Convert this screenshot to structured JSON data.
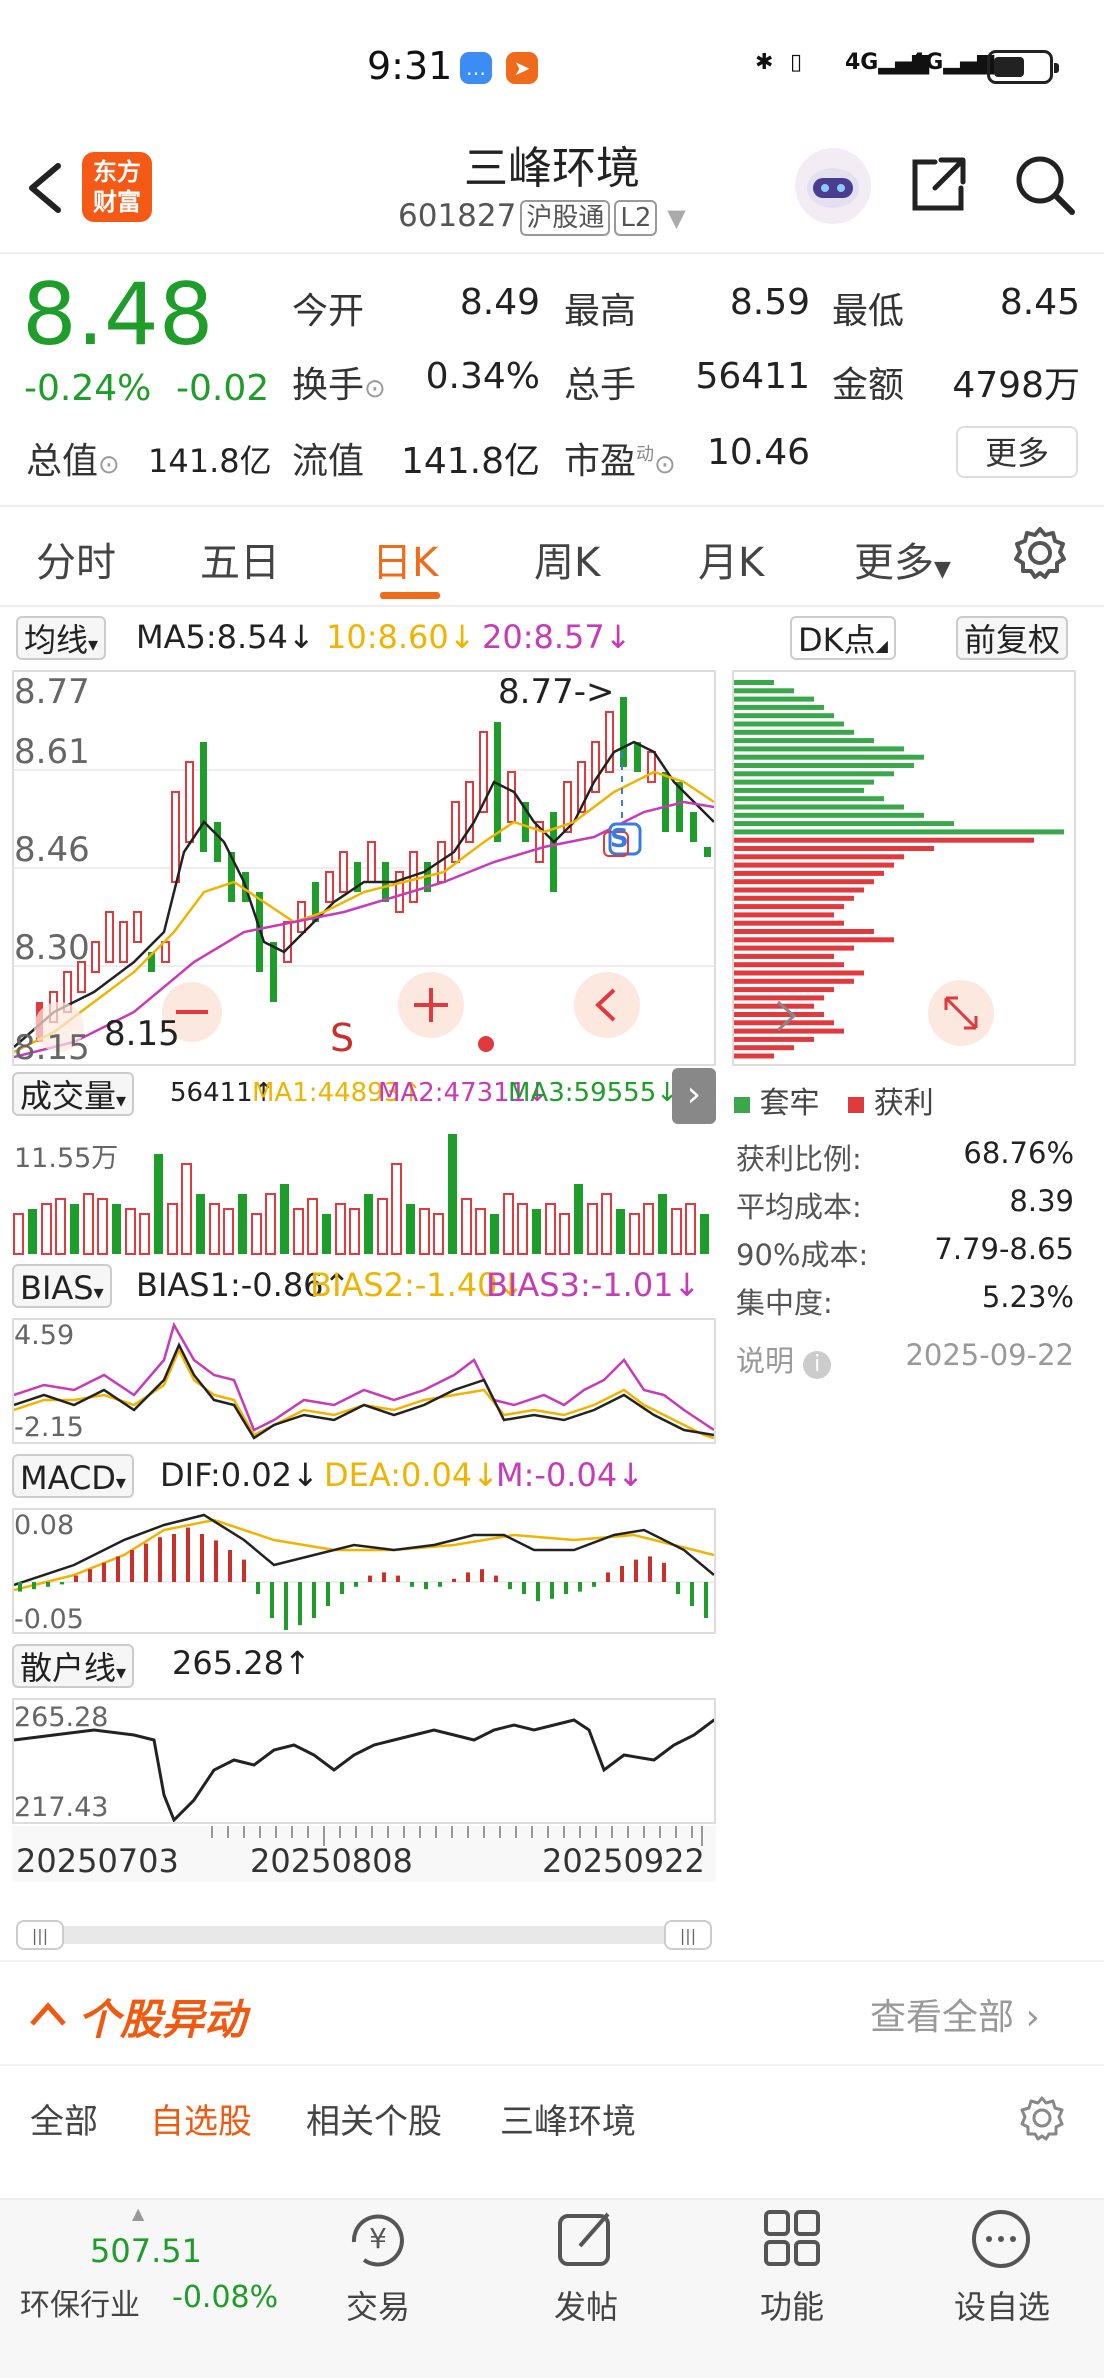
{
  "status_bar": {
    "time": "9:31",
    "signal1": "4G",
    "signal2": "4G"
  },
  "header": {
    "stock_name": "三峰环境",
    "code": "601827",
    "tag1": "沪股通",
    "tag2": "L2",
    "logo_line1": "东方",
    "logo_line2": "财富"
  },
  "quote": {
    "price": "8.48",
    "change_pct": "-0.24%",
    "change": "-0.02",
    "open_label": "今开",
    "open": "8.49",
    "high_label": "最高",
    "high": "8.59",
    "low_label": "最低",
    "low": "8.45",
    "turnover_label": "换手",
    "turnover": "0.34%",
    "volume_label": "总手",
    "volume": "56411",
    "amount_label": "金额",
    "amount": "4798万",
    "mktcap_label": "总值",
    "mktcap": "141.8亿",
    "float_label": "流值",
    "float": "141.8亿",
    "pe_label": "市盈",
    "pe_sup": "动",
    "pe": "10.46",
    "more_button": "更多"
  },
  "tabs": [
    "分时",
    "五日",
    "日K",
    "周K",
    "月K",
    "更多"
  ],
  "active_tab": "日K",
  "kline": {
    "ma_selector": "均线",
    "ma5": "MA5:8.54↓",
    "ma10": "10:8.60↓",
    "ma20": "20:8.57↓",
    "dk_button": "DK点",
    "adjust_button": "前复权",
    "y_labels": [
      "8.77",
      "8.61",
      "8.46",
      "8.30",
      "8.15"
    ],
    "max_label": "8.77->",
    "min_label": "8.15",
    "sell_marker": "S",
    "colors": {
      "up": "#e0393e",
      "down": "#1e9d2a",
      "ma5": "#222222",
      "ma10": "#f0b400",
      "ma20": "#c73bb8"
    }
  },
  "volume": {
    "selector": "成交量",
    "vol": "56411↑",
    "ma1": "MA1:44893↑",
    "ma2": "MA2:47311↓",
    "ma3": "MA3:59555↓",
    "max_label": "11.55万"
  },
  "bias": {
    "selector": "BIAS",
    "b1": "BIAS1:-0.86↑",
    "b2": "BIAS2:-1.40↓",
    "b3": "BIAS3:-1.01↓",
    "top": "4.59",
    "bottom": "-2.15"
  },
  "macd": {
    "selector": "MACD",
    "dif": "DIF:0.02↓",
    "dea": "DEA:0.04↓",
    "m": "M:-0.04↓",
    "top": "0.08",
    "bottom": "-0.05"
  },
  "retail": {
    "selector": "散户线",
    "value": "265.28↑",
    "top": "265.28",
    "bottom": "217.43"
  },
  "dates": [
    "20250703",
    "20250808",
    "20250922"
  ],
  "chips": {
    "legend_trapped": "套牢",
    "legend_profit": "获利",
    "rows": [
      {
        "label": "获利比例:",
        "value": "68.76%"
      },
      {
        "label": "平均成本:",
        "value": "8.39"
      },
      {
        "label": "90%成本:",
        "value": "7.79-8.65"
      },
      {
        "label": "集中度:",
        "value": "5.23%"
      }
    ],
    "note_label": "说明",
    "date": "2025-09-22"
  },
  "movement": {
    "title": "个股异动",
    "view_all": "查看全部",
    "filters": [
      "全部",
      "自选股",
      "相关个股",
      "三峰环境"
    ],
    "active_filter": "自选股"
  },
  "bottom_bar": {
    "index_value": "507.51",
    "index_name": "环保行业",
    "index_change": "-0.08%",
    "trade": "交易",
    "post": "发帖",
    "functions": "功能",
    "add_watch": "设自选"
  }
}
